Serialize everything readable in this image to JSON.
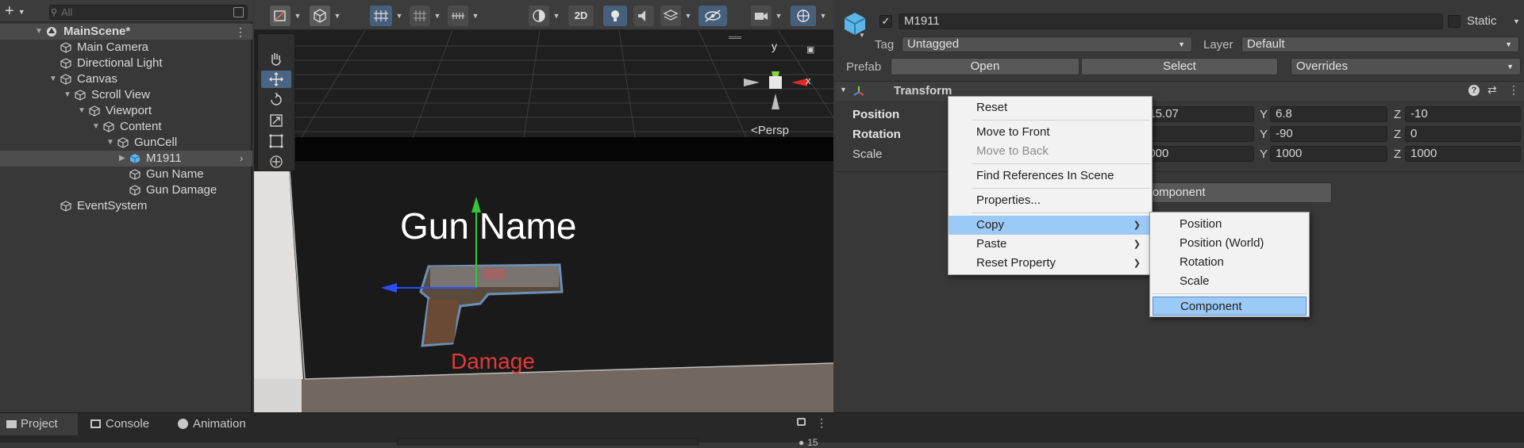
{
  "hierarchy": {
    "search_placeholder": "All",
    "scene": "MainScene*",
    "items": [
      {
        "label": "Main Camera"
      },
      {
        "label": "Directional Light"
      },
      {
        "label": "Canvas"
      },
      {
        "label": "Scroll View"
      },
      {
        "label": "Viewport"
      },
      {
        "label": "Content"
      },
      {
        "label": "GunCell"
      },
      {
        "label": "M1911"
      },
      {
        "label": "Gun Name"
      },
      {
        "label": "Gun Damage"
      },
      {
        "label": "EventSystem"
      }
    ]
  },
  "scene_view": {
    "mode_2d": "2D",
    "gizmo_y": "y",
    "gizmo_x": "x",
    "persp": "Persp",
    "gun_name": "Gun Name",
    "damage": "Damage"
  },
  "inspector": {
    "object_name": "M1911",
    "static_label": "Static",
    "tag_label": "Tag",
    "tag_value": "Untagged",
    "layer_label": "Layer",
    "layer_value": "Default",
    "prefab_label": "Prefab",
    "open_button": "Open",
    "select_button": "Select",
    "overrides": "Overrides",
    "component_title": "Transform",
    "position_label": "Position",
    "rotation_label": "Rotation",
    "scale_label": "Scale",
    "position": {
      "x": "615.07",
      "y": "6.8",
      "z": "-10"
    },
    "rotation": {
      "x": "",
      "y": "-90",
      "z": "0"
    },
    "scale": {
      "x": "1000",
      "y": "1000",
      "z": "1000"
    },
    "y_label": "Y",
    "z_label": "Z",
    "add_component": "Component"
  },
  "context_menu": {
    "items": [
      "Reset",
      "Move to Front",
      "Move to Back",
      "Find References In Scene",
      "Properties...",
      "Copy",
      "Paste",
      "Reset Property"
    ]
  },
  "copy_submenu": {
    "items": [
      "Position",
      "Position (World)",
      "Rotation",
      "Scale",
      "Component"
    ]
  },
  "bottom_tabs": {
    "project": "Project",
    "console": "Console",
    "animation": "Animation",
    "count": "15"
  },
  "colors": {
    "highlight": "#9ccaf6",
    "damage_text": "#e23a3a",
    "selection_blue": "#4a6483"
  }
}
